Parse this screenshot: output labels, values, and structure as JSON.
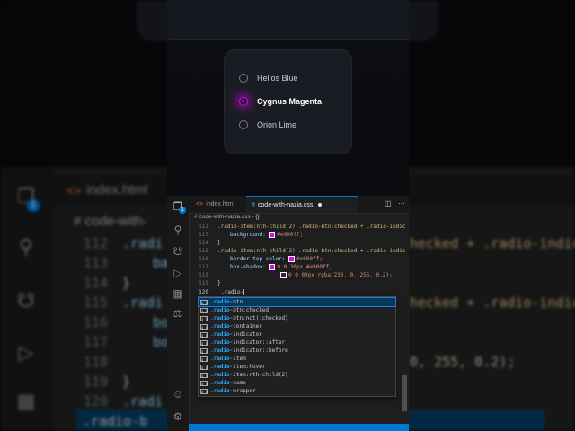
{
  "background": {
    "tab": "index.html",
    "breadcrumb": "# code-with-",
    "lines": [
      {
        "num": "112",
        "code": ".radi"
      },
      {
        "num": "113",
        "code": "ba"
      },
      {
        "num": "114",
        "code": "}"
      },
      {
        "num": "115",
        "code": ".radi"
      },
      {
        "num": "116",
        "code": "bo"
      },
      {
        "num": "117",
        "code": "bo"
      },
      {
        "num": "118",
        "code": ""
      },
      {
        "num": "119",
        "code": "}"
      },
      {
        "num": "120",
        "code": ".radi"
      },
      {
        "num": "121",
        "code": ".radio-b"
      }
    ],
    "right_texts": [
      "hecked + .radio-indic",
      "hecked + .radio-indic",
      "0, 255, 0.2);"
    ],
    "badge": "1"
  },
  "preview": {
    "radio_options": [
      {
        "label": "Helios Blue",
        "checked": false
      },
      {
        "label": "Cygnus Magenta",
        "checked": true
      },
      {
        "label": "Orion Lime",
        "checked": false
      }
    ],
    "accent_color": "#e900ff"
  },
  "editor": {
    "tabs": [
      {
        "label": "index.html",
        "active": false
      },
      {
        "label": "code-with-nazia.css",
        "active": true,
        "modified": true
      }
    ],
    "badge": "1",
    "breadcrumb": {
      "file": "code-with-nazia.css",
      "symbol": "{}"
    },
    "tab_glyph_html": "<>",
    "tab_glyph_css": "#",
    "tab_actions": [
      "split-editor-icon",
      "more-icon"
    ],
    "activity_icons": [
      "explorer-icon",
      "search-icon",
      "source-control-icon",
      "run-debug-icon",
      "extensions-icon",
      "testing-icon",
      "account-icon",
      "settings-icon"
    ],
    "lines": [
      {
        "num": "112",
        "text": ".radio-item:nth-child(2) .radio-btn:checked + .radio-indic"
      },
      {
        "num": "113",
        "prop": "background:",
        "value": "#e900ff;",
        "swatch": true
      },
      {
        "num": "114",
        "text": "}"
      },
      {
        "num": "115",
        "text": ".radio-item:nth-child(2) .radio-btn:checked + .radio-indic"
      },
      {
        "num": "116",
        "prop": "border-top-color:",
        "value": "#e900ff;",
        "swatch": true
      },
      {
        "num": "117",
        "prop": "box-shadow:",
        "value": "0 0 30px #e900ff,",
        "swatch": true
      },
      {
        "num": "118",
        "prop": "",
        "value": "0 0 00px rgba(233, 0, 255, 0.2);",
        "swatch": true
      },
      {
        "num": "119",
        "text": "}"
      },
      {
        "num": "120",
        "text": ".radio-",
        "current": true
      }
    ],
    "suggestions": [
      {
        "match": ".radio-",
        "rest": "btn",
        "selected": true
      },
      {
        "match": ".radio-",
        "rest": "btn:checked"
      },
      {
        "match": ".radio-",
        "rest": "btn:not(:checked)"
      },
      {
        "match": ".radio-",
        "rest": "container"
      },
      {
        "match": ".radio-",
        "rest": "indicator"
      },
      {
        "match": ".radio-",
        "rest": "indicator::after"
      },
      {
        "match": ".radio-",
        "rest": "indicator::before"
      },
      {
        "match": ".radio-",
        "rest": "item"
      },
      {
        "match": ".radio-",
        "rest": "item:hover"
      },
      {
        "match": ".radio-",
        "rest": "item:nth-child(2)"
      },
      {
        "match": ".radio-",
        "rest": "name"
      },
      {
        "match": ".radio-",
        "rest": "wrapper"
      }
    ],
    "suggestion_icon_label": "a b",
    "status_color": "#0078d4"
  }
}
